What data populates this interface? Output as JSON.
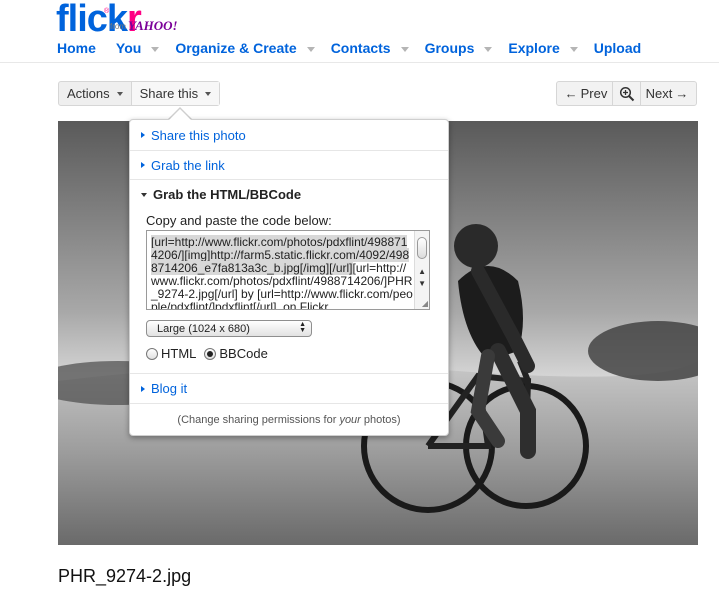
{
  "brand": {
    "logo_main": "flick",
    "logo_accent": "r",
    "registered": "®",
    "from": "from",
    "yahoo": "YAHOO!"
  },
  "nav": {
    "items": [
      {
        "label": "Home",
        "has_menu": false
      },
      {
        "label": "You",
        "has_menu": true
      },
      {
        "label": "Organize & Create",
        "has_menu": true
      },
      {
        "label": "Contacts",
        "has_menu": true
      },
      {
        "label": "Groups",
        "has_menu": true
      },
      {
        "label": "Explore",
        "has_menu": true
      },
      {
        "label": "Upload",
        "has_menu": false
      }
    ]
  },
  "toolbar": {
    "actions_label": "Actions",
    "share_label": "Share this",
    "prev_label": "Prev",
    "next_label": "Next",
    "prev_arrow": "←",
    "next_arrow": "→"
  },
  "share_panel": {
    "items": {
      "share_photo": "Share this photo",
      "grab_link": "Grab the link",
      "grab_html": "Grab the HTML/BBCode",
      "blog_it": "Blog it"
    },
    "copy_label": "Copy and paste the code below:",
    "code_selected": "[url=http://www.flickr.com/photos/pdxflint/4988714206/][img]http://farm5.static.flickr.com/4092/4988714206_e7fa813a3c_b.jpg[/img][/url]",
    "code_rest": "[url=http://www.flickr.com/photos/pdxflint/4988714206/]PHR_9274-2.jpg[/url] by [url=http://www.flickr.com/people/pdxflint/]pdxflint[/url], on Flickr",
    "size_selected": "Large (1024 x 680)",
    "format_options": {
      "html": "HTML",
      "bbcode": "BBCode",
      "selected": "BBCode"
    },
    "permissions_prefix": "(Change sharing permissions for ",
    "permissions_em": "your",
    "permissions_suffix": " photos)"
  },
  "photo": {
    "filename": "PHR_9274-2.jpg"
  }
}
